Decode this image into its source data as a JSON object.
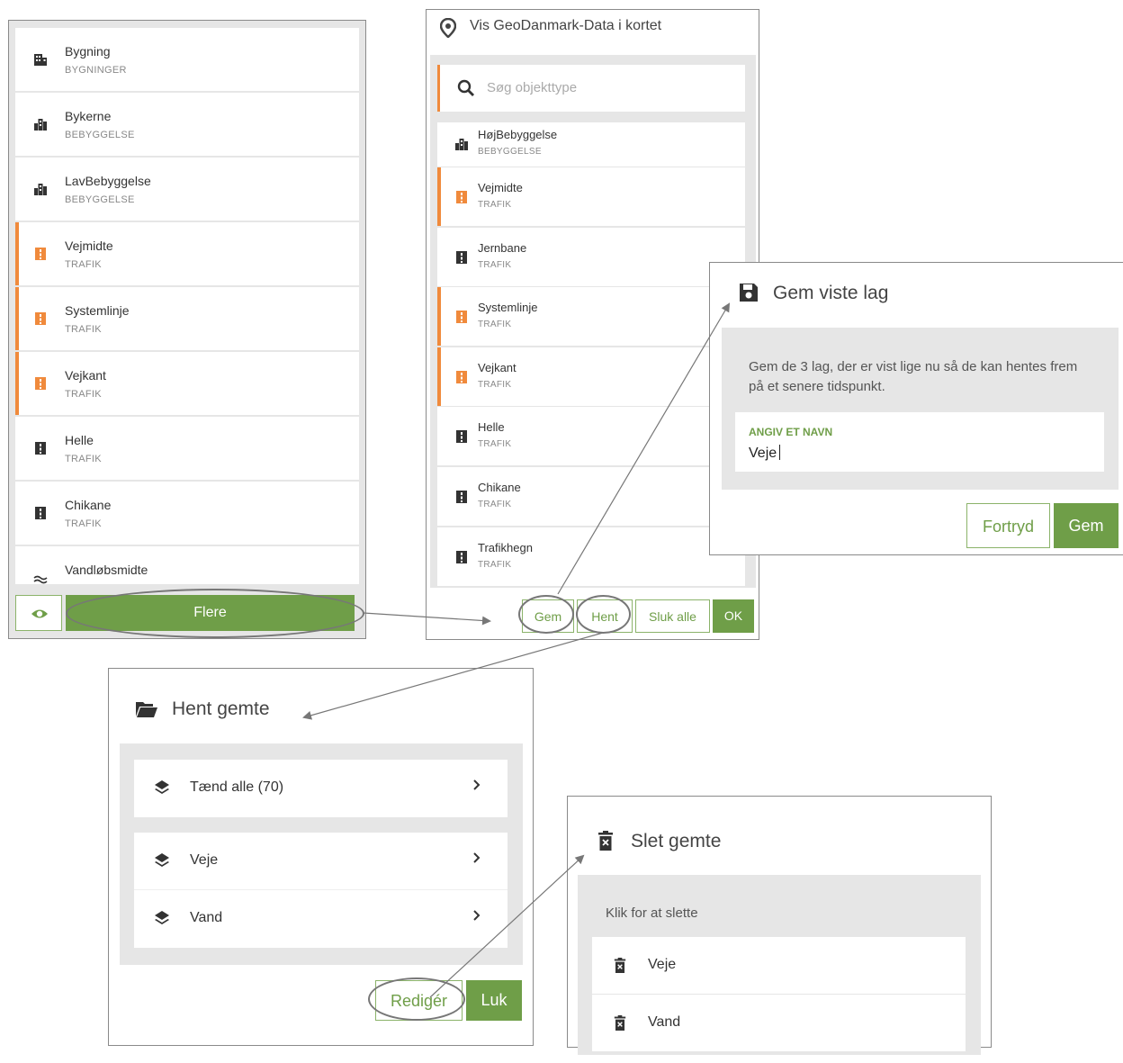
{
  "panel1": {
    "items": [
      {
        "name": "Bygning",
        "cat": "BYGNINGER",
        "icon": "building-icon"
      },
      {
        "name": "Bykerne",
        "cat": "BEBYGGELSE",
        "icon": "city-icon"
      },
      {
        "name": "LavBebyggelse",
        "cat": "BEBYGGELSE",
        "icon": "city-icon"
      },
      {
        "name": "Vejmidte",
        "cat": "TRAFIK",
        "icon": "road-icon"
      },
      {
        "name": "Systemlinje",
        "cat": "TRAFIK",
        "icon": "road-icon"
      },
      {
        "name": "Vejkant",
        "cat": "TRAFIK",
        "icon": "road-icon"
      },
      {
        "name": "Helle",
        "cat": "TRAFIK",
        "icon": "road-icon"
      },
      {
        "name": "Chikane",
        "cat": "TRAFIK",
        "icon": "road-icon"
      },
      {
        "name": "Vandløbsmidte",
        "cat": "",
        "icon": "water-icon"
      }
    ],
    "more_label": "Flere",
    "eye_icon": "eye-icon"
  },
  "panel2": {
    "title": "Vis GeoDanmark-Data i kortet",
    "search_placeholder": "Søg objekttype",
    "items": [
      {
        "name": "HøjBebyggelse",
        "cat": "BEBYGGELSE",
        "icon": "city-icon"
      },
      {
        "name": "Vejmidte",
        "cat": "TRAFIK",
        "icon": "road-icon"
      },
      {
        "name": "Jernbane",
        "cat": "TRAFIK",
        "icon": "road-icon"
      },
      {
        "name": "Systemlinje",
        "cat": "TRAFIK",
        "icon": "road-icon"
      },
      {
        "name": "Vejkant",
        "cat": "TRAFIK",
        "icon": "road-icon"
      },
      {
        "name": "Helle",
        "cat": "TRAFIK",
        "icon": "road-icon"
      },
      {
        "name": "Chikane",
        "cat": "TRAFIK",
        "icon": "road-icon"
      },
      {
        "name": "Trafikhegn",
        "cat": "TRAFIK",
        "icon": "road-icon"
      }
    ],
    "btn_gem": "Gem",
    "btn_hent": "Hent",
    "btn_sluk": "Sluk alle",
    "btn_ok": "OK"
  },
  "panel3": {
    "title": "Gem viste lag",
    "description": "Gem de 3 lag, der er vist lige nu så de kan hentes frem på et senere tidspunkt.",
    "field_label": "ANGIV ET NAVN",
    "field_value": "Veje",
    "btn_cancel": "Fortryd",
    "btn_save": "Gem"
  },
  "panel4": {
    "title": "Hent gemte",
    "items": [
      {
        "label": "Tænd alle (70)"
      },
      {
        "label": "Veje"
      },
      {
        "label": "Vand"
      }
    ],
    "btn_edit": "Redigér",
    "btn_close": "Luk"
  },
  "panel5": {
    "title": "Slet gemte",
    "hint": "Klik for at slette",
    "items": [
      {
        "label": "Veje"
      },
      {
        "label": "Vand"
      }
    ]
  },
  "colors": {
    "accent_green": "#6f9e48",
    "active_orange": "#f08a3c"
  }
}
